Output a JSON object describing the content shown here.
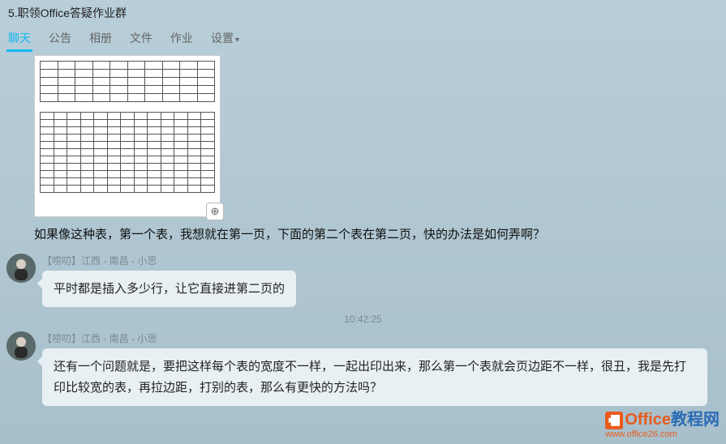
{
  "header": {
    "title": "5.职领Office答疑作业群"
  },
  "tabs": {
    "items": [
      {
        "label": "聊天",
        "active": true
      },
      {
        "label": "公告"
      },
      {
        "label": "相册"
      },
      {
        "label": "文件"
      },
      {
        "label": "作业"
      },
      {
        "label": "设置",
        "dropdown": true
      }
    ]
  },
  "messages": {
    "first": {
      "text": "如果像这种表，第一个表，我想就在第一页，下面的第二个表在第二页，快的办法是如何弄啊？",
      "zoom_icon": "magnifier-plus"
    },
    "second": {
      "name": "【唠叨】江西 - 南昌 - 小思",
      "text": "平时都是插入多少行，让它直接进第二页的"
    },
    "timestamp": "10:42:25",
    "third": {
      "name": "【唠叨】江西 - 南昌 - 小思",
      "text": "还有一个问题就是，要把这样每个表的宽度不一样，一起出印出来，那么第一个表就会页边距不一样，很丑，我是先打印比较宽的表，再拉边距，打别的表，那么有更快的方法吗？"
    }
  },
  "watermark": {
    "line1_orange": "Office",
    "line1_blue": "教程网",
    "line2": "www.office26.com"
  }
}
